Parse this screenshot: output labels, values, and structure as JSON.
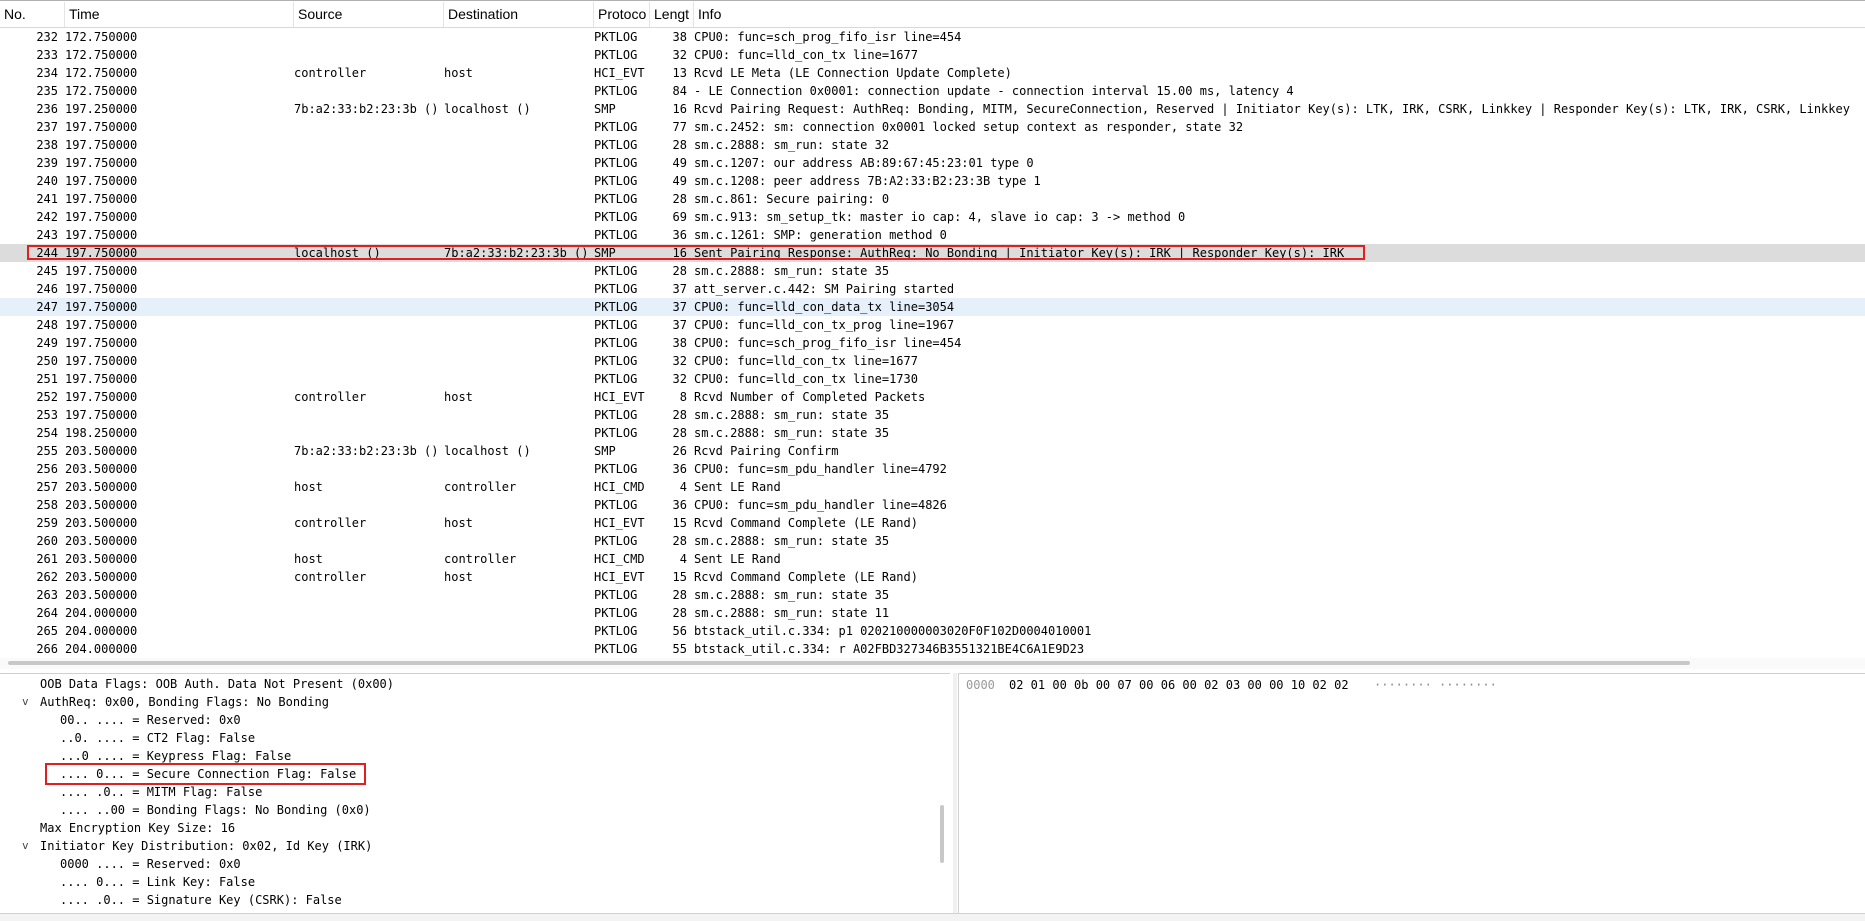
{
  "columns": {
    "no": "No.",
    "time": "Time",
    "source": "Source",
    "destination": "Destination",
    "protocol": "Protoco",
    "length": "Lengt",
    "info": "Info"
  },
  "packets": [
    {
      "no": "232",
      "time": "172.750000",
      "src": "",
      "dst": "",
      "proto": "PKTLOG",
      "len": "38",
      "info": "CPU0: func=sch_prog_fifo_isr line=454"
    },
    {
      "no": "233",
      "time": "172.750000",
      "src": "",
      "dst": "",
      "proto": "PKTLOG",
      "len": "32",
      "info": "CPU0: func=lld_con_tx line=1677"
    },
    {
      "no": "234",
      "time": "172.750000",
      "src": "controller",
      "dst": "host",
      "proto": "HCI_EVT",
      "len": "13",
      "info": "Rcvd LE Meta (LE Connection Update Complete)"
    },
    {
      "no": "235",
      "time": "172.750000",
      "src": "",
      "dst": "",
      "proto": "PKTLOG",
      "len": "84",
      "info": "- LE Connection 0x0001: connection update - connection interval 15.00 ms, latency 4"
    },
    {
      "no": "236",
      "time": "197.250000",
      "src": "7b:a2:33:b2:23:3b ()",
      "dst": "localhost ()",
      "proto": "SMP",
      "len": "16",
      "info": "Rcvd Pairing Request: AuthReq: Bonding, MITM, SecureConnection, Reserved | Initiator Key(s): LTK, IRK, CSRK, Linkkey | Responder Key(s): LTK, IRK, CSRK, Linkkey"
    },
    {
      "no": "237",
      "time": "197.750000",
      "src": "",
      "dst": "",
      "proto": "PKTLOG",
      "len": "77",
      "info": "sm.c.2452: sm: connection 0x0001 locked setup context as responder, state 32"
    },
    {
      "no": "238",
      "time": "197.750000",
      "src": "",
      "dst": "",
      "proto": "PKTLOG",
      "len": "28",
      "info": "sm.c.2888: sm_run: state 32"
    },
    {
      "no": "239",
      "time": "197.750000",
      "src": "",
      "dst": "",
      "proto": "PKTLOG",
      "len": "49",
      "info": "sm.c.1207: our  address AB:89:67:45:23:01 type 0"
    },
    {
      "no": "240",
      "time": "197.750000",
      "src": "",
      "dst": "",
      "proto": "PKTLOG",
      "len": "49",
      "info": "sm.c.1208: peer address 7B:A2:33:B2:23:3B type 1"
    },
    {
      "no": "241",
      "time": "197.750000",
      "src": "",
      "dst": "",
      "proto": "PKTLOG",
      "len": "28",
      "info": "sm.c.861: Secure pairing: 0"
    },
    {
      "no": "242",
      "time": "197.750000",
      "src": "",
      "dst": "",
      "proto": "PKTLOG",
      "len": "69",
      "info": "sm.c.913: sm_setup_tk: master io cap: 4, slave io cap: 3 -> method 0"
    },
    {
      "no": "243",
      "time": "197.750000",
      "src": "",
      "dst": "",
      "proto": "PKTLOG",
      "len": "36",
      "info": "sm.c.1261: SMP: generation method 0"
    },
    {
      "no": "244",
      "time": "197.750000",
      "src": "localhost ()",
      "dst": "7b:a2:33:b2:23:3b ()",
      "proto": "SMP",
      "len": "16",
      "info": "Sent Pairing Response: AuthReq: No Bonding | Initiator Key(s): IRK | Responder Key(s): IRK"
    },
    {
      "no": "245",
      "time": "197.750000",
      "src": "",
      "dst": "",
      "proto": "PKTLOG",
      "len": "28",
      "info": "sm.c.2888: sm_run: state 35"
    },
    {
      "no": "246",
      "time": "197.750000",
      "src": "",
      "dst": "",
      "proto": "PKTLOG",
      "len": "37",
      "info": "att_server.c.442: SM Pairing started"
    },
    {
      "no": "247",
      "time": "197.750000",
      "src": "",
      "dst": "",
      "proto": "PKTLOG",
      "len": "37",
      "info": "CPU0: func=lld_con_data_tx line=3054"
    },
    {
      "no": "248",
      "time": "197.750000",
      "src": "",
      "dst": "",
      "proto": "PKTLOG",
      "len": "37",
      "info": "CPU0: func=lld_con_tx_prog line=1967"
    },
    {
      "no": "249",
      "time": "197.750000",
      "src": "",
      "dst": "",
      "proto": "PKTLOG",
      "len": "38",
      "info": "CPU0: func=sch_prog_fifo_isr line=454"
    },
    {
      "no": "250",
      "time": "197.750000",
      "src": "",
      "dst": "",
      "proto": "PKTLOG",
      "len": "32",
      "info": "CPU0: func=lld_con_tx line=1677"
    },
    {
      "no": "251",
      "time": "197.750000",
      "src": "",
      "dst": "",
      "proto": "PKTLOG",
      "len": "32",
      "info": "CPU0: func=lld_con_tx line=1730"
    },
    {
      "no": "252",
      "time": "197.750000",
      "src": "controller",
      "dst": "host",
      "proto": "HCI_EVT",
      "len": "8",
      "info": "Rcvd Number of Completed Packets"
    },
    {
      "no": "253",
      "time": "197.750000",
      "src": "",
      "dst": "",
      "proto": "PKTLOG",
      "len": "28",
      "info": "sm.c.2888: sm_run: state 35"
    },
    {
      "no": "254",
      "time": "198.250000",
      "src": "",
      "dst": "",
      "proto": "PKTLOG",
      "len": "28",
      "info": "sm.c.2888: sm_run: state 35"
    },
    {
      "no": "255",
      "time": "203.500000",
      "src": "7b:a2:33:b2:23:3b ()",
      "dst": "localhost ()",
      "proto": "SMP",
      "len": "26",
      "info": "Rcvd Pairing Confirm"
    },
    {
      "no": "256",
      "time": "203.500000",
      "src": "",
      "dst": "",
      "proto": "PKTLOG",
      "len": "36",
      "info": "CPU0: func=sm_pdu_handler line=4792"
    },
    {
      "no": "257",
      "time": "203.500000",
      "src": "host",
      "dst": "controller",
      "proto": "HCI_CMD",
      "len": "4",
      "info": "Sent LE Rand"
    },
    {
      "no": "258",
      "time": "203.500000",
      "src": "",
      "dst": "",
      "proto": "PKTLOG",
      "len": "36",
      "info": "CPU0: func=sm_pdu_handler line=4826"
    },
    {
      "no": "259",
      "time": "203.500000",
      "src": "controller",
      "dst": "host",
      "proto": "HCI_EVT",
      "len": "15",
      "info": "Rcvd Command Complete (LE Rand)"
    },
    {
      "no": "260",
      "time": "203.500000",
      "src": "",
      "dst": "",
      "proto": "PKTLOG",
      "len": "28",
      "info": "sm.c.2888: sm_run: state 35"
    },
    {
      "no": "261",
      "time": "203.500000",
      "src": "host",
      "dst": "controller",
      "proto": "HCI_CMD",
      "len": "4",
      "info": "Sent LE Rand"
    },
    {
      "no": "262",
      "time": "203.500000",
      "src": "controller",
      "dst": "host",
      "proto": "HCI_EVT",
      "len": "15",
      "info": "Rcvd Command Complete (LE Rand)"
    },
    {
      "no": "263",
      "time": "203.500000",
      "src": "",
      "dst": "",
      "proto": "PKTLOG",
      "len": "28",
      "info": "sm.c.2888: sm_run: state 35"
    },
    {
      "no": "264",
      "time": "204.000000",
      "src": "",
      "dst": "",
      "proto": "PKTLOG",
      "len": "28",
      "info": "sm.c.2888: sm_run: state 11"
    },
    {
      "no": "265",
      "time": "204.000000",
      "src": "",
      "dst": "",
      "proto": "PKTLOG",
      "len": "56",
      "info": "btstack_util.c.334: p1 020210000003020F0F102D0004010001"
    },
    {
      "no": "266",
      "time": "204.000000",
      "src": "",
      "dst": "",
      "proto": "PKTLOG",
      "len": "55",
      "info": "btstack_util.c.334: r A02FBD327346B3551321BE4C6A1E9D23"
    }
  ],
  "selected_packet": "244",
  "highlighted_packet": "247",
  "details": [
    {
      "level": 0,
      "twisty": "",
      "text": "OOB Data Flags: OOB Auth. Data Not Present (0x00)"
    },
    {
      "level": 0,
      "twisty": "v",
      "text": "AuthReq: 0x00, Bonding Flags: No Bonding"
    },
    {
      "level": 1,
      "twisty": "",
      "text": "00.. .... = Reserved: 0x0"
    },
    {
      "level": 1,
      "twisty": "",
      "text": "..0. .... = CT2 Flag: False"
    },
    {
      "level": 1,
      "twisty": "",
      "text": "...0 .... = Keypress Flag: False"
    },
    {
      "level": 1,
      "twisty": "",
      "text": ".... 0... = Secure Connection Flag: False"
    },
    {
      "level": 1,
      "twisty": "",
      "text": ".... .0.. = MITM Flag: False"
    },
    {
      "level": 1,
      "twisty": "",
      "text": ".... ..00 = Bonding Flags: No Bonding (0x0)"
    },
    {
      "level": 0,
      "twisty": "",
      "text": "Max Encryption Key Size: 16"
    },
    {
      "level": 0,
      "twisty": "v",
      "text": "Initiator Key Distribution: 0x02, Id Key (IRK)"
    },
    {
      "level": 1,
      "twisty": "",
      "text": "0000 .... = Reserved: 0x0"
    },
    {
      "level": 1,
      "twisty": "",
      "text": ".... 0... = Link Key: False"
    },
    {
      "level": 1,
      "twisty": "",
      "text": ".... .0.. = Signature Key (CSRK): False"
    }
  ],
  "bytes": {
    "offset": "0000",
    "hex": "02 01 00 0b 00 07 00 06  00 02 03 00 00 10 02 02",
    "ascii": "········ ········"
  },
  "colors": {
    "selected_row": "#dcdcdc",
    "highlight_row": "#e6f0fb",
    "annotation_red": "#e02020"
  }
}
